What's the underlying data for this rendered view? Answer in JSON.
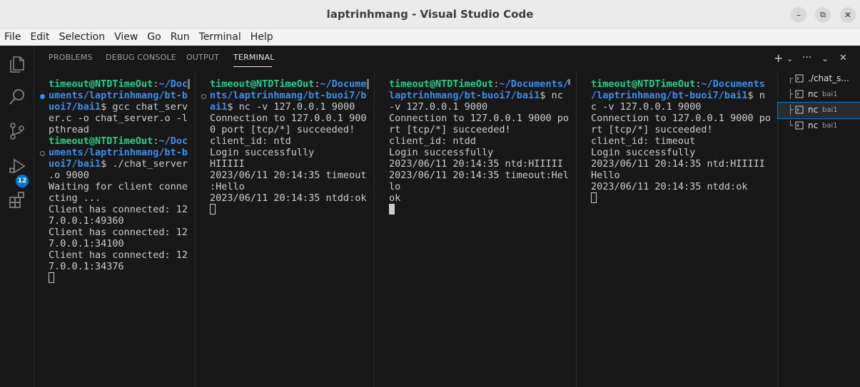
{
  "window": {
    "title": "laptrinhmang - Visual Studio Code"
  },
  "menu": [
    "File",
    "Edit",
    "Selection",
    "View",
    "Go",
    "Run",
    "Terminal",
    "Help"
  ],
  "activity": {
    "source_control_badge": "12"
  },
  "panel": {
    "tabs": [
      "PROBLEMS",
      "DEBUG CONSOLE",
      "OUTPUT",
      "TERMINAL"
    ],
    "active_tab": "TERMINAL"
  },
  "terminals": [
    {
      "lines": [
        {
          "u": "timeout@NTDTimeOut",
          "c": ":",
          "p": "~/Doc"
        },
        {
          "p": "uments/laptrinhmang/bt-b"
        },
        {
          "p": "uoi7/bai1",
          "t": "$ gcc chat_serv"
        },
        {
          "t": "er.c -o chat_server.o -l"
        },
        {
          "t": "pthread"
        },
        {
          "u": "timeout@NTDTimeOut",
          "c": ":",
          "p": "~/Doc"
        },
        {
          "p": "uments/laptrinhmang/bt-b"
        },
        {
          "p": "uoi7/bai1",
          "t": "$ ./chat_server"
        },
        {
          "t": ".o 9000"
        },
        {
          "t": "Waiting for client conne"
        },
        {
          "t": "cting ..."
        },
        {
          "t": "Client has connected: 12"
        },
        {
          "t": "7.0.0.1:49360"
        },
        {
          "t": "Client has connected: 12"
        },
        {
          "t": "7.0.0.1:34100"
        },
        {
          "t": "Client has connected: 12"
        },
        {
          "t": "7.0.0.1:34376"
        }
      ]
    },
    {
      "lines": [
        {
          "u": "timeout@NTDTimeOut",
          "c": ":",
          "p": "~/Docume"
        },
        {
          "p": "nts/laptrinhmang/bt-buoi7/b"
        },
        {
          "p": "ai1",
          "t": "$ nc -v 127.0.0.1 9000"
        },
        {
          "t": "Connection to 127.0.0.1 900"
        },
        {
          "t": "0 port [tcp/*] succeeded!"
        },
        {
          "t": "client_id: ntd"
        },
        {
          "t": "Login successfully"
        },
        {
          "t": "HIIIII"
        },
        {
          "t": "2023/06/11 20:14:35 timeout"
        },
        {
          "t": ":Hello"
        },
        {
          "t": "2023/06/11 20:14:35 ntdd:ok"
        }
      ]
    },
    {
      "lines": [
        {
          "u": "timeout@NTDTimeOut",
          "c": ":",
          "p": "~/Documents/"
        },
        {
          "p": "laptrinhmang/bt-buoi7/bai1",
          "t": "$ nc"
        },
        {
          "t": "-v 127.0.0.1 9000"
        },
        {
          "t": "Connection to 127.0.0.1 9000 po"
        },
        {
          "t": "rt [tcp/*] succeeded!"
        },
        {
          "t": "client_id: ntdd"
        },
        {
          "t": "Login successfully"
        },
        {
          "t": "2023/06/11 20:14:35 ntd:HIIIII"
        },
        {
          "t": "2023/06/11 20:14:35 timeout:Hel"
        },
        {
          "t": "lo"
        },
        {
          "t": "ok"
        }
      ]
    },
    {
      "lines": [
        {
          "u": "timeout@NTDTimeOut",
          "c": ":",
          "p": "~/Documents"
        },
        {
          "p": "/laptrinhmang/bt-buoi7/bai1",
          "t": "$ n"
        },
        {
          "t": "c -v 127.0.0.1 9000"
        },
        {
          "t": "Connection to 127.0.0.1 9000 po"
        },
        {
          "t": "rt [tcp/*] succeeded!"
        },
        {
          "t": "client_id: timeout"
        },
        {
          "t": "Login successfully"
        },
        {
          "t": "2023/06/11 20:14:35 ntd:HIIIII"
        },
        {
          "t": "Hello"
        },
        {
          "t": "2023/06/11 20:14:35 ntdd:ok"
        }
      ]
    }
  ],
  "terminal_list": [
    {
      "name": "./chat_s...",
      "desc": ""
    },
    {
      "name": "nc",
      "desc": "bai1"
    },
    {
      "name": "nc",
      "desc": "bai1"
    },
    {
      "name": "nc",
      "desc": "bai1"
    }
  ],
  "colors": {
    "user": "#23d18b",
    "path": "#3b8eea",
    "accent": "#0078d4"
  }
}
